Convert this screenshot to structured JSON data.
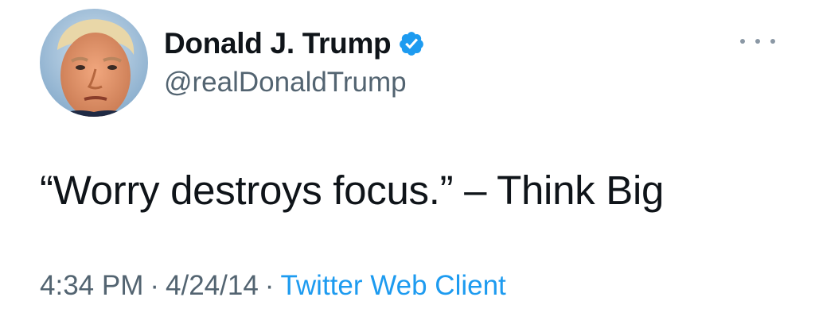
{
  "user": {
    "display_name": "Donald J. Trump",
    "handle": "@realDonaldTrump",
    "verified": true,
    "verified_color": "#1d9bf0"
  },
  "tweet": {
    "text": "“Worry destroys focus.” – Think Big"
  },
  "meta": {
    "time": "4:34 PM",
    "separator": "·",
    "date": "4/24/14",
    "source": "Twitter Web Client",
    "source_color": "#1d9bf0"
  },
  "icons": {
    "more": "more-options-icon",
    "verified": "verified-badge-icon"
  }
}
